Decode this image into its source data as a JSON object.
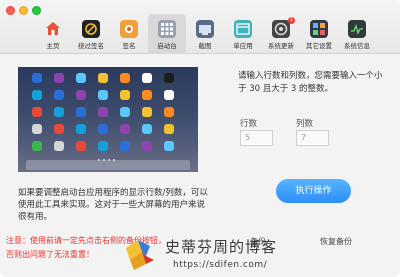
{
  "toolbar": {
    "tabs": [
      {
        "label": "主页",
        "icon": "home-icon",
        "color": "#e5533d",
        "active": false
      },
      {
        "label": "绕过签名",
        "icon": "bypass-signature-icon",
        "color": "#222222",
        "active": false
      },
      {
        "label": "签名",
        "icon": "signature-icon",
        "color": "#f0a03a",
        "active": false
      },
      {
        "label": "启动台",
        "icon": "launchpad-icon",
        "color": "#8a8fa0",
        "active": true
      },
      {
        "label": "截图",
        "icon": "screenshot-icon",
        "color": "#5a6b8a",
        "active": false
      },
      {
        "label": "单应用",
        "icon": "single-app-icon",
        "color": "#3fb3b8",
        "active": false
      },
      {
        "label": "系统更新",
        "icon": "system-update-icon",
        "color": "#444444",
        "active": false,
        "badge": "1"
      },
      {
        "label": "其它设置",
        "icon": "other-settings-icon",
        "color": "#2e3a4a",
        "active": false
      },
      {
        "label": "系统信息",
        "icon": "system-info-icon",
        "color": "#2f3b3b",
        "active": false
      }
    ]
  },
  "main": {
    "instructions": "请输入行数和列数，您需要输入一个小于 30 且大于 3 的整数。",
    "rows_label": "行数",
    "rows_value": "5",
    "cols_label": "列数",
    "cols_value": "7",
    "run_button": "执行操作",
    "description": "如果要调整启动台应用程序的显示行数/列数，可以使用此工具来实现。这对于一些大屏幕的用户来说很有用。",
    "warning_line1": "注意：使用前请一定先点击右侧的备份按钮，",
    "warning_line2": "否则出问题了无法重置！",
    "backup_label": "备份",
    "restore_label": "恢复备份"
  },
  "watermark": {
    "title": "史蒂芬周的博客",
    "url": "https://sdifen.com/"
  },
  "colors": {
    "accent": "#2d8ef7",
    "warning": "#e4332e"
  }
}
